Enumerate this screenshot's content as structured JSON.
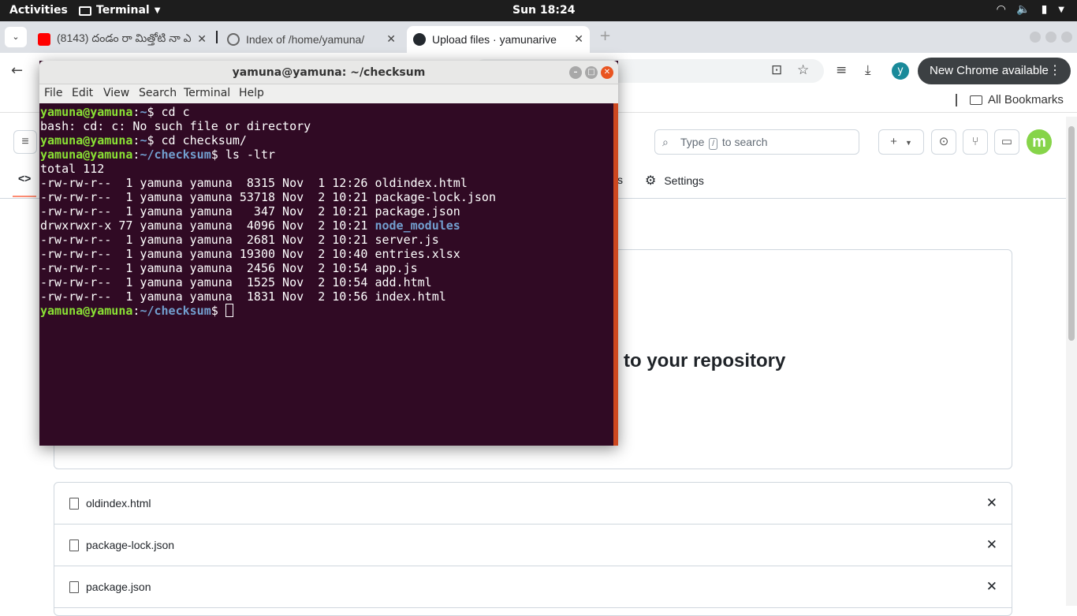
{
  "topbar": {
    "activities": "Activities",
    "app": "Terminal",
    "clock": "Sun 18:24"
  },
  "browser": {
    "tabs": [
      {
        "title": "(8143) దండం రా మిత్తోటి నా ఎ",
        "favicon": "youtube-icon"
      },
      {
        "title": "Index of /home/yamuna/",
        "favicon": "globe-icon"
      },
      {
        "title": "Upload files · yamunarive",
        "favicon": "github-icon"
      }
    ],
    "avatar_letter": "y",
    "update_label": "New Chrome available",
    "bookmarks_label": "All Bookmarks"
  },
  "github": {
    "search_prefix": "Type",
    "search_key": "/",
    "search_suffix": "to search",
    "tab_partial": "s",
    "settings_label": "Settings",
    "drop_title": "to your repository",
    "files": [
      "oldindex.html",
      "package-lock.json",
      "package.json"
    ]
  },
  "terminal": {
    "title": "yamuna@yamuna: ~/checksum",
    "menu": [
      "File",
      "Edit",
      "View",
      "Search",
      "Terminal",
      "Help"
    ],
    "prompt_user": "yamuna@yamuna",
    "cmd1": "cd c",
    "err1": "bash: cd: c: No such file or directory",
    "cmd2": "cd checksum/",
    "path": "~/checksum",
    "cmd3": "ls -ltr",
    "total": "total 112",
    "listing": [
      {
        "meta": "-rw-rw-r--  1 yamuna yamuna  8315 Nov  1 12:26 ",
        "name": "oldindex.html",
        "dir": false
      },
      {
        "meta": "-rw-rw-r--  1 yamuna yamuna 53718 Nov  2 10:21 ",
        "name": "package-lock.json",
        "dir": false
      },
      {
        "meta": "-rw-rw-r--  1 yamuna yamuna   347 Nov  2 10:21 ",
        "name": "package.json",
        "dir": false
      },
      {
        "meta": "drwxrwxr-x 77 yamuna yamuna  4096 Nov  2 10:21 ",
        "name": "node_modules",
        "dir": true
      },
      {
        "meta": "-rw-rw-r--  1 yamuna yamuna  2681 Nov  2 10:21 ",
        "name": "server.js",
        "dir": false
      },
      {
        "meta": "-rw-rw-r--  1 yamuna yamuna 19300 Nov  2 10:40 ",
        "name": "entries.xlsx",
        "dir": false
      },
      {
        "meta": "-rw-rw-r--  1 yamuna yamuna  2456 Nov  2 10:54 ",
        "name": "app.js",
        "dir": false
      },
      {
        "meta": "-rw-rw-r--  1 yamuna yamuna  1525 Nov  2 10:54 ",
        "name": "add.html",
        "dir": false
      },
      {
        "meta": "-rw-rw-r--  1 yamuna yamuna  1831 Nov  2 10:56 ",
        "name": "index.html",
        "dir": false
      }
    ]
  }
}
